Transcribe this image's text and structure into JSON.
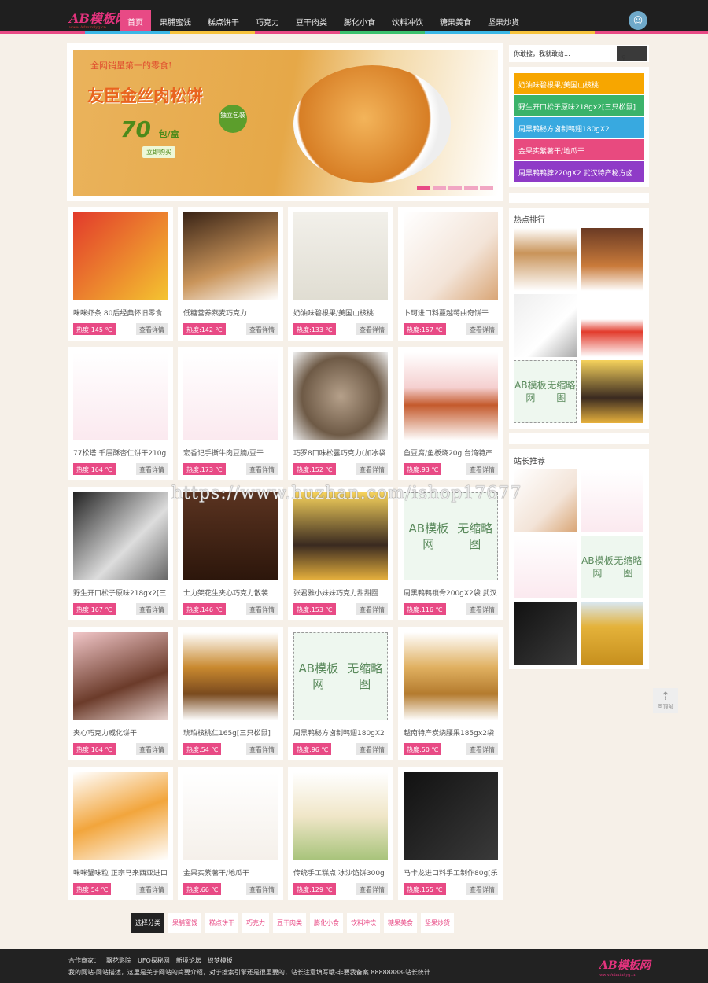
{
  "header": {
    "logo": "AB模板网",
    "logo_sub": "www.Admin8yg.cn",
    "nav": [
      "首页",
      "果脯蜜饯",
      "糕点饼干",
      "巧克力",
      "豆干肉类",
      "膨化小食",
      "饮料冲饮",
      "糖果美食",
      "坚果炒货"
    ],
    "active_nav": 0
  },
  "banner": {
    "slogan": "全网销量第一的零食!",
    "title": "友臣金丝肉松饼",
    "count": "70",
    "unit": "包/盒",
    "buy": "立即购买",
    "badge": "独立包装",
    "slides": 5,
    "active_slide": 0
  },
  "search": {
    "placeholder": "你敢搜，我就敢给...",
    "icon": "search-icon"
  },
  "featured": [
    {
      "label": "奶油味碧根果/美国山核桃",
      "color": "#f7a600"
    },
    {
      "label": "野生开口松子原味218gx2[三只松鼠]",
      "color": "#3bb36a"
    },
    {
      "label": "周黑鸭秘方卤制鸭翅180gX2",
      "color": "#38a9e0"
    },
    {
      "label": "金果实紫薯干/地瓜干",
      "color": "#e84a7f"
    },
    {
      "label": "周黑鸭鸭脖220gX2 武汉特产秘方卤",
      "color": "#8f3bc7"
    }
  ],
  "hot_rank": {
    "title": "热点排行"
  },
  "recommend": {
    "title": "站长推荐"
  },
  "placeholder_text": [
    "AB模板网",
    "无缩略图"
  ],
  "products": [
    {
      "title": "咪咪虾条 80后经典怀旧零食",
      "heat": "热度:145 ℃"
    },
    {
      "title": "低糖营养燕麦巧克力",
      "heat": "热度:142 ℃"
    },
    {
      "title": "奶油味碧根果/美国山核桃",
      "heat": "热度:133 ℃"
    },
    {
      "title": "卜珂进口料蔓越莓曲奇饼干",
      "heat": "热度:157 ℃"
    },
    {
      "title": "77松塔 千层酥杏仁饼干210g",
      "heat": "热度:164 ℃"
    },
    {
      "title": "宏香记手撕牛肉豆腩/豆干",
      "heat": "热度:173 ℃"
    },
    {
      "title": "巧罗8口味松露巧克力(加冰袋",
      "heat": "热度:152 ℃"
    },
    {
      "title": "鱼豆腐/鱼板烧20g 台湾特产",
      "heat": "热度:93 ℃"
    },
    {
      "title": "野生开口松子原味218gx2[三",
      "heat": "热度:167 ℃"
    },
    {
      "title": "士力架花生夹心巧克力散装",
      "heat": "热度:146 ℃"
    },
    {
      "title": "张君雅小妹妹巧克力甜甜圈",
      "heat": "热度:153 ℃"
    },
    {
      "title": "周黑鸭鸭锁骨200gX2袋 武汉",
      "heat": "热度:116 ℃"
    },
    {
      "title": "夹心巧克力威化饼干",
      "heat": "热度:164 ℃"
    },
    {
      "title": "琥珀核桃仁165g[三只松鼠]",
      "heat": "热度:54 ℃"
    },
    {
      "title": "周黑鸭秘方卤制鸭翅180gX2",
      "heat": "热度:96 ℃"
    },
    {
      "title": "越南特产炭烧腰果185gx2袋",
      "heat": "热度:50 ℃"
    },
    {
      "title": "咪咪蟹味粒 正宗马来西亚进口",
      "heat": "热度:54 ℃"
    },
    {
      "title": "金果实紫薯干/地瓜干",
      "heat": "热度:66 ℃"
    },
    {
      "title": "传统手工糕点 冰沙馅饼300g",
      "heat": "热度:129 ℃"
    },
    {
      "title": "马卡龙进口料手工制作80g[乐",
      "heat": "热度:155 ℃"
    }
  ],
  "more_label": "查看详情",
  "categories": {
    "lead": "选择分类",
    "items": [
      "果脯蜜饯",
      "糕点饼干",
      "巧克力",
      "豆干肉类",
      "膨化小食",
      "饮料冲饮",
      "糖果美食",
      "坚果炒货"
    ]
  },
  "footer": {
    "partners_label": "合作商家：",
    "partners": [
      "飘花影院",
      "UFO探秘网",
      "新境论坛",
      "织梦模板"
    ],
    "desc": "我的网站-网站描述，这里是关于网站的简要介绍，对于搜索引擎还是很重要的，站长注意填写哦-非要我备案 88888888-站长统计",
    "logo": "AB模板网",
    "logo_sub": "www.Admin8yg.cn"
  },
  "back_to_top": "回顶部",
  "watermark": "https://www.huzhan.com/ishop17677"
}
